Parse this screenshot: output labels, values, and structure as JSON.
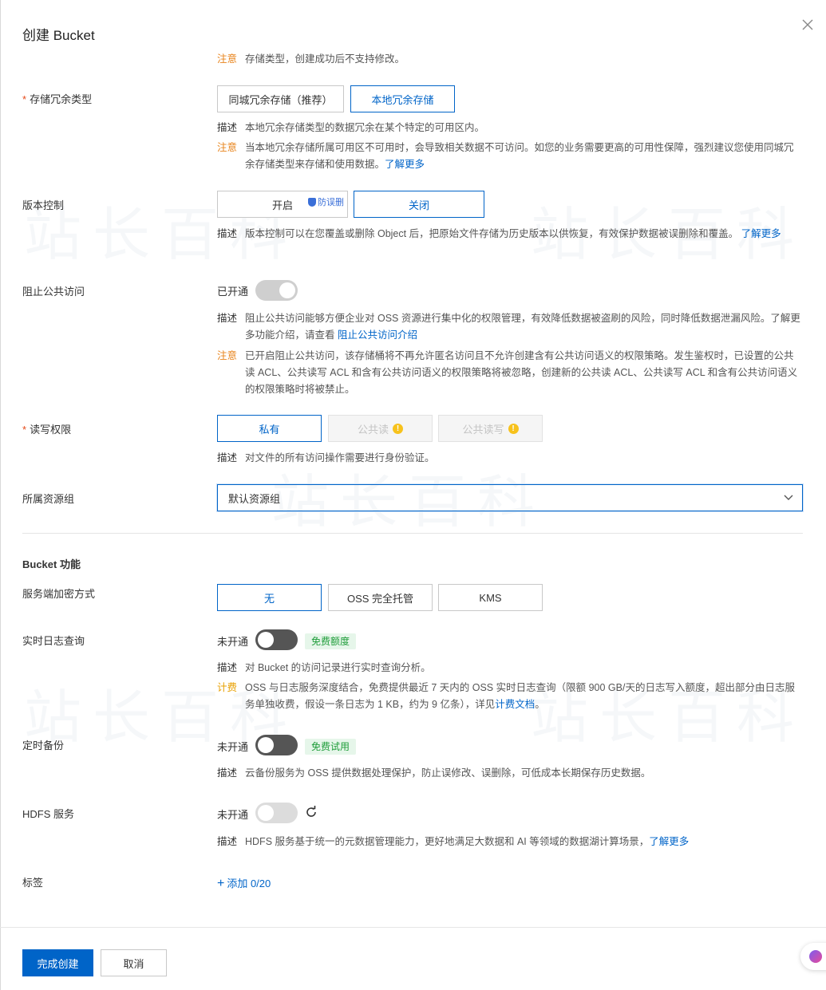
{
  "dialog": {
    "title": "创建 Bucket",
    "close_icon": "close-icon"
  },
  "top_note": {
    "key": "注意",
    "text": "存储类型，创建成功后不支持修改。"
  },
  "redundancy": {
    "label": "存储冗余类型",
    "options": [
      "同城冗余存储（推荐）",
      "本地冗余存储"
    ],
    "selected": "本地冗余存储",
    "desc_key": "描述",
    "desc": "本地冗余存储类型的数据冗余在某个特定的可用区内。",
    "warn_key": "注意",
    "warn": "当本地冗余存储所属可用区不可用时，会导致相关数据不可访问。如您的业务需要更高的可用性保障，强烈建议您使用同城冗余存储类型来存储和使用数据。",
    "warn_link": "了解更多"
  },
  "versioning": {
    "label": "版本控制",
    "options": [
      "开启",
      "关闭"
    ],
    "selected": "关闭",
    "badge": "防误删",
    "desc_key": "描述",
    "desc": "版本控制可以在您覆盖或删除 Object 后，把原始文件存储为历史版本以供恢复，有效保护数据被误删除和覆盖。",
    "desc_link": "了解更多"
  },
  "block_public": {
    "label": "阻止公共访问",
    "status": "已开通",
    "desc_key": "描述",
    "desc": "阻止公共访问能够方便企业对 OSS 资源进行集中化的权限管理，有效降低数据被盗刷的风险，同时降低数据泄漏风险。了解更多功能介绍，请查看",
    "desc_link": "阻止公共访问介绍",
    "warn_key": "注意",
    "warn": "已开启阻止公共访问，该存储桶将不再允许匿名访问且不允许创建含有公共访问语义的权限策略。发生鉴权时，已设置的公共读 ACL、公共读写 ACL 和含有公共访问语义的权限策略将被忽略，创建新的公共读 ACL、公共读写 ACL 和含有公共访问语义的权限策略时将被禁止。"
  },
  "acl": {
    "label": "读写权限",
    "options": [
      "私有",
      "公共读",
      "公共读写"
    ],
    "selected": "私有",
    "desc_key": "描述",
    "desc": "对文件的所有访问操作需要进行身份验证。"
  },
  "resource_group": {
    "label": "所属资源组",
    "value": "默认资源组"
  },
  "features": {
    "title": "Bucket 功能"
  },
  "encryption": {
    "label": "服务端加密方式",
    "options": [
      "无",
      "OSS 完全托管",
      "KMS"
    ],
    "selected": "无"
  },
  "realtime_log": {
    "label": "实时日志查询",
    "status": "未开通",
    "tag": "免费额度",
    "desc_key": "描述",
    "desc": "对 Bucket 的访问记录进行实时查询分析。",
    "fee_key": "计费",
    "fee": "OSS 与日志服务深度结合，免费提供最近 7 天内的 OSS 实时日志查询（限额 900 GB/天的日志写入额度，超出部分由日志服务单独收费，假设一条日志为 1 KB，约为 9 亿条），详见",
    "fee_link": "计费文档",
    "fee_tail": "。"
  },
  "backup": {
    "label": "定时备份",
    "status": "未开通",
    "tag": "免费试用",
    "desc_key": "描述",
    "desc": "云备份服务为 OSS 提供数据处理保护，防止误修改、误删除，可低成本长期保存历史数据。"
  },
  "hdfs": {
    "label": "HDFS 服务",
    "status": "未开通",
    "desc_key": "描述",
    "desc": "HDFS 服务基于统一的元数据管理能力，更好地满足大数据和 AI 等领域的数据湖计算场景，",
    "desc_link": "了解更多"
  },
  "tags": {
    "label": "标签",
    "add": "添加 0/20"
  },
  "footer": {
    "submit": "完成创建",
    "cancel": "取消"
  },
  "colors": {
    "primary": "#0064c8",
    "warn": "#e8841c",
    "green": "#1f9d3a"
  }
}
